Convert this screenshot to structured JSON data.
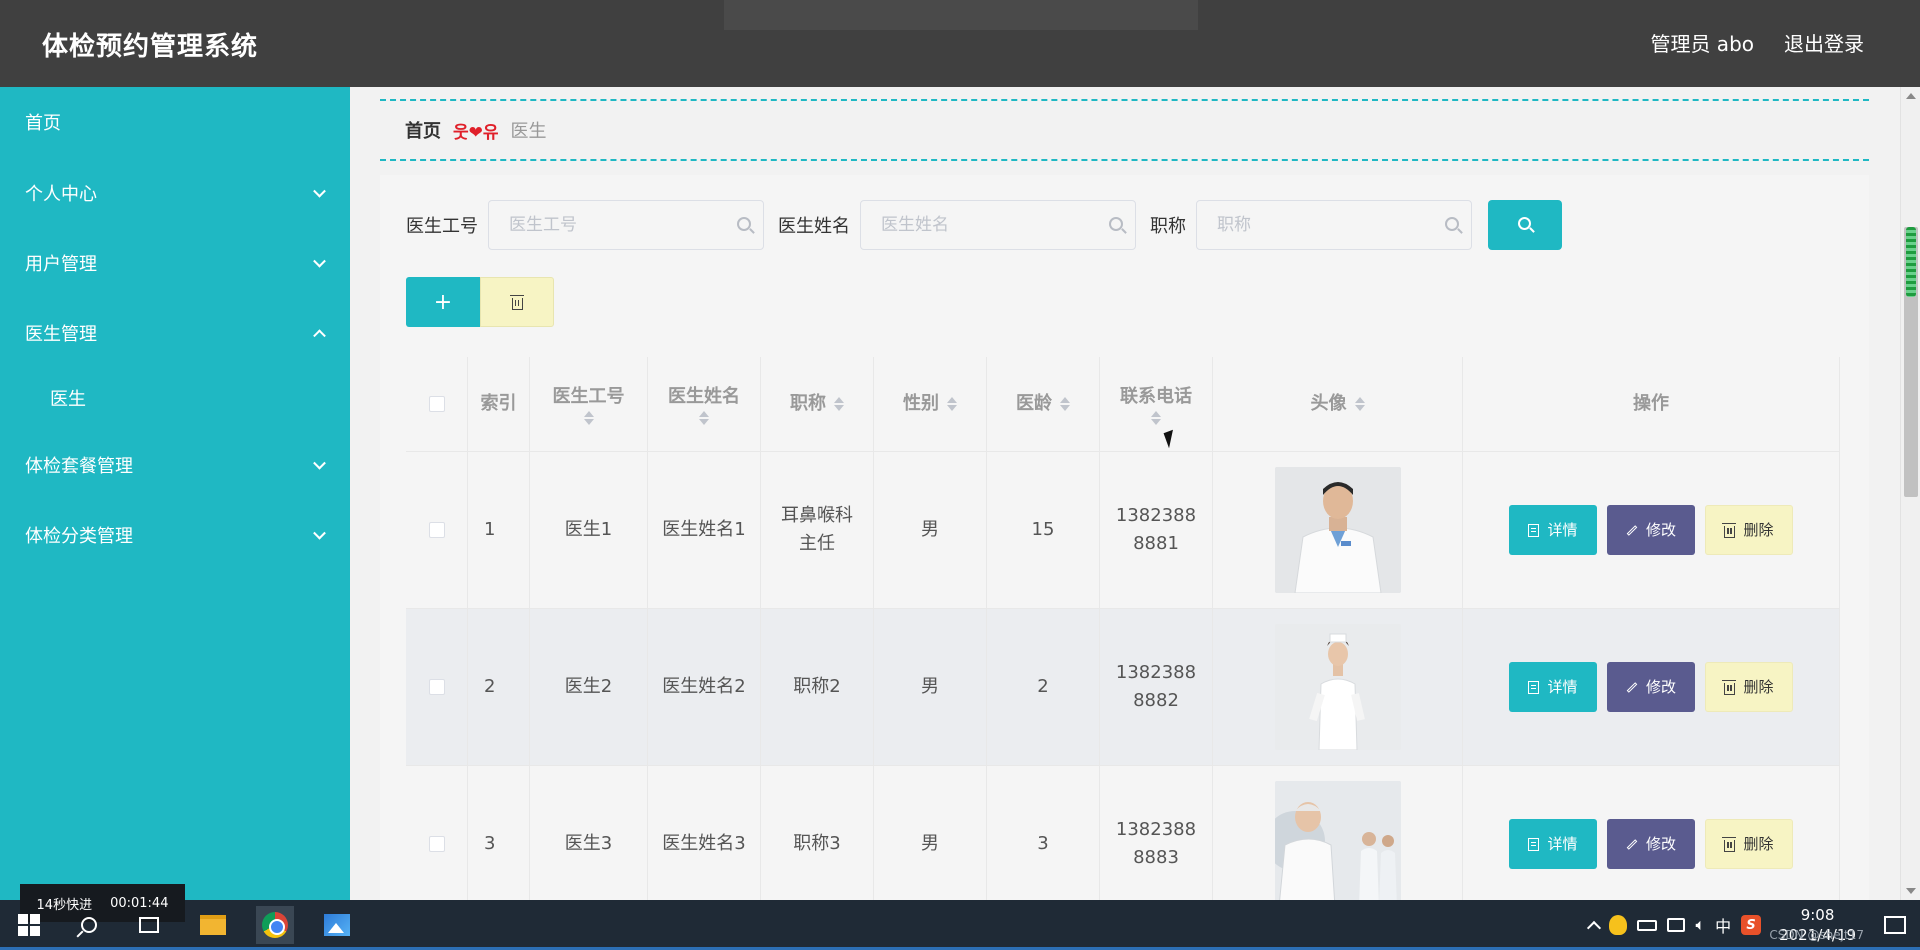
{
  "header": {
    "title": "体检预约管理系统",
    "admin": "管理员 abo",
    "logout": "退出登录"
  },
  "sidebar": {
    "items": [
      {
        "label": "首页",
        "expandable": false
      },
      {
        "label": "个人中心",
        "expandable": true
      },
      {
        "label": "用户管理",
        "expandable": true
      },
      {
        "label": "医生管理",
        "expandable": true,
        "expanded": true
      },
      {
        "label": "医生",
        "sub": true
      },
      {
        "label": "体检套餐管理",
        "expandable": true
      },
      {
        "label": "体检分类管理",
        "expandable": true
      }
    ]
  },
  "breadcrumb": {
    "home": "首页",
    "decor": "웃❤유",
    "current": "医生"
  },
  "search": {
    "fields": [
      {
        "label": "医生工号",
        "placeholder": "医生工号"
      },
      {
        "label": "医生姓名",
        "placeholder": "医生姓名"
      },
      {
        "label": "职称",
        "placeholder": "职称"
      }
    ],
    "button_icon": "search-icon"
  },
  "actions": {
    "add_label": "+",
    "delete_icon": "trash-icon"
  },
  "table": {
    "columns": [
      "索引",
      "医生工号",
      "医生姓名",
      "职称",
      "性别",
      "医龄",
      "联系电话",
      "头像",
      "操作"
    ],
    "rows": [
      {
        "index": "1",
        "code": "医生1",
        "name": "医生姓名1",
        "title": "耳鼻喉科主任",
        "gender": "男",
        "years": "15",
        "phone": "13823888881"
      },
      {
        "index": "2",
        "code": "医生2",
        "name": "医生姓名2",
        "title": "职称2",
        "gender": "男",
        "years": "2",
        "phone": "13823888882"
      },
      {
        "index": "3",
        "code": "医生3",
        "name": "医生姓名3",
        "title": "职称3",
        "gender": "男",
        "years": "3",
        "phone": "13823888883"
      }
    ],
    "op_labels": {
      "detail": "详情",
      "edit": "修改",
      "remove": "删除"
    }
  },
  "taskbar": {
    "speed_label": "14秒快进",
    "speed_time": "00:01:44",
    "ime": "中",
    "time": "9:08",
    "date": "2021/4/19",
    "watermark": "CSDN @shejt17"
  },
  "colors": {
    "accent": "#1fb8c3",
    "header": "#404040",
    "edit": "#5a5b8f",
    "remove": "#f7f4c4"
  }
}
